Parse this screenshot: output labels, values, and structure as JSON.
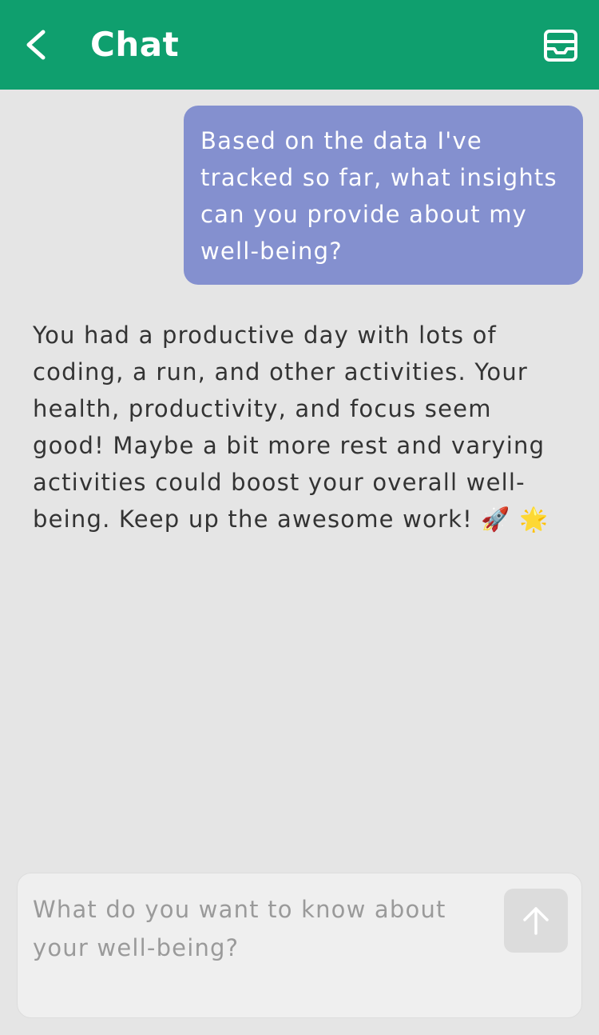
{
  "header": {
    "title": "Chat",
    "back_icon": "chevron-left-icon",
    "inbox_icon": "inbox-icon",
    "background_color": "#0f9f6e"
  },
  "messages": [
    {
      "role": "user",
      "text": "Based on the data I've\ntracked so far, what insights\ncan you provide about my\nwell-being?",
      "bubble_color": "#8490cf"
    },
    {
      "role": "assistant",
      "text": "You had a productive day with lots of\ncoding, a run, and other activities. Your\nhealth, productivity, and focus seem\ngood! Maybe a bit more rest and varying\nactivities could boost your overall well-\nbeing. Keep up the awesome work! 🚀 🌟"
    }
  ],
  "composer": {
    "placeholder": "What do you want to know about\nyour well-being?",
    "send_icon": "arrow-up-icon"
  }
}
